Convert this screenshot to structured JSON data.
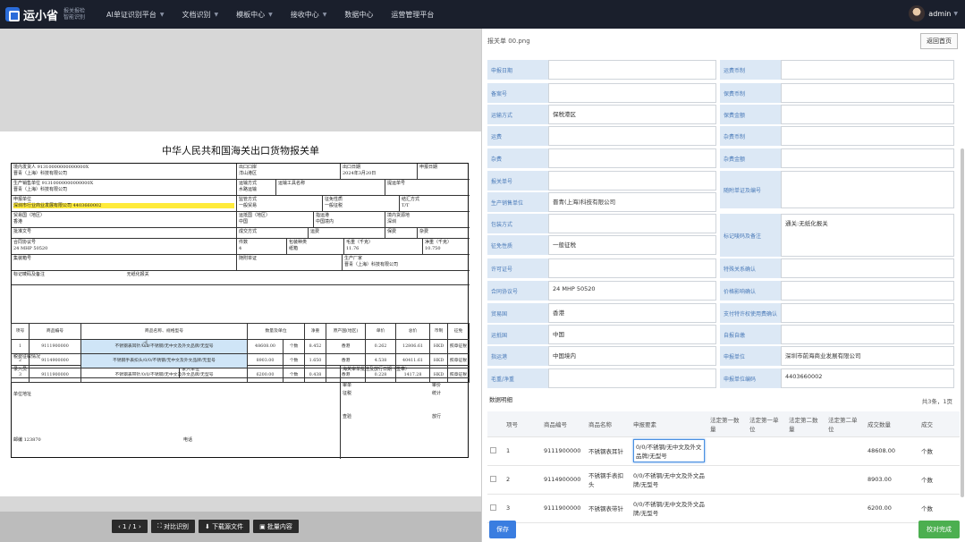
{
  "header": {
    "logo_text": "运小省",
    "logo_sub": "报关报检 智能识别",
    "nav": [
      "AI单证识别平台",
      "文档识别",
      "模板中心",
      "接收中心",
      "数据中心",
      "运营管理平台"
    ],
    "user": "admin"
  },
  "doc": {
    "title": "中华人民共和国海关出口货物报关单",
    "cells": {
      "consignor": "境内发货人 91310000000000000X\n晋青（上海）科技有限公司",
      "export_port": "出口口岸\n洋山港区",
      "export_date": "出口日期\n2024年3月20日",
      "declare_date": "申报日期",
      "producer": "生产销售单位 91310000000000000X\n晋青（上海）科技有限公司",
      "transport": "运输方式\n水路运输",
      "transport_tool": "运输工具名称",
      "bill_no": "提运单号",
      "declarant": "申报单位",
      "declarant_name": "深圳市行业商业发展有限公司 4403660002",
      "supervision": "监管方式\n一般贸易",
      "tax_nature": "征免性质\n一般征税",
      "settlement": "结汇方式\nT/T",
      "trade_country": "贸易国（地区）\n香港",
      "dest_country": "运抵国（地区）\n中国",
      "port": "指运港\n中国境内",
      "domestic_source": "境内货源地\n深圳",
      "license": "批准文号",
      "trans_terms": "成交方式",
      "freight": "运费",
      "insurance": "保费",
      "misc": "杂费",
      "contract": "合同协议号\n24 MHP 50520",
      "pieces": "件数\n4",
      "package": "包装种类\n纸箱",
      "gross": "毛重（千克）\n11.76",
      "net": "净重（千克）\n10.750",
      "container": "集装箱号",
      "attach": "随附单证",
      "maker": "生产厂家\n晋青（上海）科技有限公司",
      "marks": "标记唛码及备注",
      "marks2": "无纸化报关"
    },
    "goods_header": [
      "项号",
      "商品编号",
      "商品名称、规格型号",
      "数量及单位",
      "净重",
      "原产国(地区)",
      "单价",
      "总价",
      "币制",
      "征免"
    ],
    "goods": [
      [
        "1",
        "9111900000",
        "不锈钢表耳针/0/0/不锈钢/无中文及外文品牌/无型号",
        "48608.00",
        "个数",
        "8.452",
        "香港",
        "0.262",
        "12806.61",
        "HKD",
        "照章征税"
      ],
      [
        "2",
        "9114900000",
        "不锈钢手表扣头/0/0/不锈钢/无中文及外文品牌/无型号",
        "8903.00",
        "个数",
        "1.650",
        "香港",
        "4.538",
        "40411.61",
        "HKD",
        "照章征税"
      ],
      [
        "3",
        "9111900000",
        "不锈钢表带针/0/0/不锈钢/无中文及外文品牌/无型号",
        "6200.00",
        "个数",
        "0.438",
        "香港",
        "0.228",
        "1417.28",
        "HKD",
        "照章征税"
      ]
    ],
    "footer": {
      "tax": "税费征收情况",
      "entry": "录入员",
      "entry_unit": "录入单位",
      "declare_note": "兹声明以上申报无讹并承担法律责任",
      "audit": "海关审单批注及放行日期（签章）",
      "unit_addr": "单位地址",
      "review": "审单",
      "approve": "审价",
      "tax_collect": "征税",
      "stats": "统计",
      "check": "查验",
      "release": "放行",
      "zip": "邮编 123870",
      "tel": "电话"
    }
  },
  "pager": {
    "page": "1 / 1",
    "compare": "对比识别",
    "download": "下载源文件",
    "batch": "批量内容"
  },
  "panel": {
    "title": "报关单 00.png",
    "back": "返回首页",
    "fields_left": [
      {
        "label": "申报日期",
        "value": ""
      },
      {
        "label": "备案号",
        "value": ""
      },
      {
        "label": "运输方式",
        "value": "保税港区"
      },
      {
        "label": "运费",
        "value": ""
      },
      {
        "label": "杂费",
        "value": ""
      },
      {
        "label": "报关单号",
        "value": ""
      },
      {
        "label": "生产销售单位",
        "value": "晋青(上海)科技有限公司"
      },
      {
        "label": "包装方式",
        "value": ""
      },
      {
        "label": "征免性质",
        "value": "一般征税"
      },
      {
        "label": "许可证号",
        "value": ""
      },
      {
        "label": "合同协议号",
        "value": "24 MHP 50520"
      },
      {
        "label": "贸易国",
        "value": "香港"
      },
      {
        "label": "运抵国",
        "value": "中国"
      },
      {
        "label": "指运港",
        "value": "中国境内"
      },
      {
        "label": "毛重/净重",
        "value": ""
      }
    ],
    "fields_right": [
      {
        "label": "运费币制",
        "value": ""
      },
      {
        "label": "保费币制",
        "value": ""
      },
      {
        "label": "保费金额",
        "value": ""
      },
      {
        "label": "杂费币制",
        "value": ""
      },
      {
        "label": "杂费金额",
        "value": ""
      },
      {
        "label": "随附单证及编号",
        "value": ""
      },
      {
        "label": "标记唛码及备注",
        "value": "通关:无纸化报关"
      },
      {
        "label": "特殊关系确认",
        "value": ""
      },
      {
        "label": "价格影响确认",
        "value": ""
      },
      {
        "label": "支付特许权使用费确认",
        "value": ""
      },
      {
        "label": "自报自缴",
        "value": ""
      },
      {
        "label": "申报单位",
        "value": "深圳市前海商业发展有限公司"
      },
      {
        "label": "申报单位编码",
        "value": "4403660002"
      }
    ],
    "table_label": "数据明细",
    "count": "共3条，1页",
    "columns": [
      "",
      "项号",
      "商品编号",
      "商品名称",
      "申报要素",
      "法定第一数量",
      "法定第一单位",
      "法定第二数量",
      "法定第二单位",
      "成交数量",
      "成交"
    ],
    "rows": [
      [
        "1",
        "9111900000",
        "不锈钢表耳针",
        "0/0/不锈钢/无中文及外文品牌/无型号",
        "48608.00",
        "个数"
      ],
      [
        "2",
        "9114900000",
        "不锈钢手表扣头",
        "0/0/不锈钢/无中文及外文品牌/无型号",
        "8903.00",
        "个数"
      ],
      [
        "3",
        "9111900000",
        "不锈钢表带针",
        "0/0/不锈钢/无中文及外文品牌/无型号",
        "6200.00",
        "个数"
      ]
    ],
    "save": "保存",
    "done": "校对完成"
  }
}
